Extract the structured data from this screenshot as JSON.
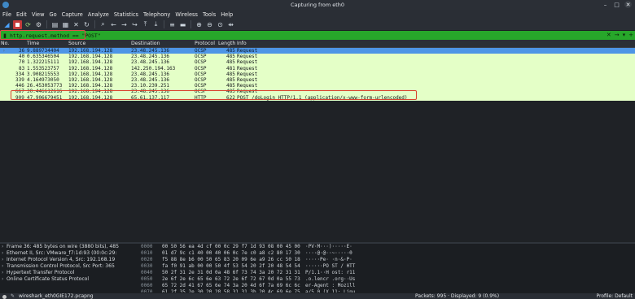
{
  "window": {
    "title": "Capturing from eth0",
    "buttons": [
      "–",
      "□",
      "✕"
    ]
  },
  "menu": [
    "File",
    "Edit",
    "View",
    "Go",
    "Capture",
    "Analyze",
    "Statistics",
    "Telephony",
    "Wireless",
    "Tools",
    "Help"
  ],
  "toolbar_icons": [
    "shark-fin-icon",
    "stop-capture-icon",
    "restart-capture-icon",
    "capture-options-icon",
    "open-file-icon",
    "save-file-icon",
    "close-file-icon",
    "reload-icon",
    "find-packet-icon",
    "back-icon",
    "forward-icon",
    "go-to-packet-icon",
    "first-packet-icon",
    "last-packet-icon",
    "autoscroll-icon",
    "colorize-icon",
    "zoom-in-icon",
    "zoom-out-icon",
    "zoom-normal-icon",
    "resize-columns-icon"
  ],
  "filter": {
    "value": "http.request.method == \"POST\""
  },
  "columns": {
    "no": "No.",
    "time": "Time",
    "source": "Source",
    "destination": "Destination",
    "protocol": "Protocol",
    "length": "Length",
    "info": "Info"
  },
  "packets": [
    {
      "no": "36",
      "time": "9.889734404",
      "source": "192.168.194.128",
      "destination": "23.48.245.136",
      "protocol": "OCSP",
      "length": "485",
      "info": "Request",
      "selected": true
    },
    {
      "no": "40",
      "time": "0.635346504",
      "source": "192.168.194.128",
      "destination": "23.48.245.136",
      "protocol": "OCSP",
      "length": "485",
      "info": "Request"
    },
    {
      "no": "70",
      "time": "1.322215111",
      "source": "192.168.194.128",
      "destination": "23.48.245.136",
      "protocol": "OCSP",
      "length": "485",
      "info": "Request"
    },
    {
      "no": "83",
      "time": "1.553523757",
      "source": "192.168.194.128",
      "destination": "142.250.194.163",
      "protocol": "OCSP",
      "length": "481",
      "info": "Request"
    },
    {
      "no": "334",
      "time": "3.908215553",
      "source": "192.168.194.128",
      "destination": "23.48.245.136",
      "protocol": "OCSP",
      "length": "485",
      "info": "Request"
    },
    {
      "no": "339",
      "time": "4.164973050",
      "source": "192.168.194.128",
      "destination": "23.48.245.136",
      "protocol": "OCSP",
      "length": "485",
      "info": "Request"
    },
    {
      "no": "446",
      "time": "26.453053773",
      "source": "192.168.194.128",
      "destination": "23.10.239.251",
      "protocol": "OCSP",
      "length": "485",
      "info": "Request"
    },
    {
      "no": "667",
      "time": "30.446612616",
      "source": "192.168.194.128",
      "destination": "23.48.245.136",
      "protocol": "OCSP",
      "length": "485",
      "info": "Request"
    },
    {
      "no": "909",
      "time": "47.906679451",
      "source": "192.168.194.128",
      "destination": "65.61.137.117",
      "protocol": "HTTP",
      "length": "622",
      "info": "POST /doLogin HTTP/1.1  (application/x-www-form-urlencoded)"
    }
  ],
  "details": [
    "Frame 36: 485 bytes on wire (3880 bits), 485",
    "Ethernet II, Src: VMware_f7:1d:93 (00:0c:29:",
    "Internet Protocol Version 4, Src: 192.168.19",
    "Transmission Control Protocol, Src Port: 365",
    "Hypertext Transfer Protocol",
    "Online Certificate Status Protocol"
  ],
  "bytes": [
    {
      "offset": "0000",
      "hex": "00 50 56 ea 4d cf 00 0c  29 f7 1d 93 08 00 45 00",
      "ascii": "·PV·M···)·····E·"
    },
    {
      "offset": "0010",
      "hex": "01 d7 9c c1 40 00 40 06  0c 7e c0 a8 c2 80 17 30",
      "ascii": "····@·@··~·····0"
    },
    {
      "offset": "0020",
      "hex": "f5 88 8e b6 00 50 65 83  20 09 6e a9 26 cc 50 18",
      "ascii": "·····Pe· ·n·&·P·"
    },
    {
      "offset": "0030",
      "hex": "fa f0 91 ab 00 00 50 4f  53 54 20 2f 20 48 54 54",
      "ascii": "······PO ST / HTT"
    },
    {
      "offset": "0040",
      "hex": "50 2f 31 2e 31 0d 0a 48  6f 73 74 3a 20 72 31 31",
      "ascii": "P/1.1··H ost: r11"
    },
    {
      "offset": "0050",
      "hex": "2e 6f 2e 6c 65 6e 63 72  2e 6f 72 67 0d 0a 55 73",
      "ascii": ".o.lencr .org··Us"
    },
    {
      "offset": "0060",
      "hex": "65 72 2d 41 67 65 6e 74  3a 20 4d 6f 7a 69 6c 6c",
      "ascii": "er-Agent : Mozill"
    },
    {
      "offset": "0070",
      "hex": "61 2f 35 2e 30 20 28 58  31 31 3b 20 4c 69 6e 75",
      "ascii": "a/5.0 (X 11; Linu"
    }
  ],
  "status": {
    "file": "wireshark_eth0GIE172.pcapng",
    "packets": "Packets: 995 · Displayed: 9 (0.9%)",
    "profile": "Profile: Default"
  },
  "colors": {
    "selected_row": "#4e95e6",
    "ocsp_row": "#e4ffc7",
    "filter_ok": "#27a72a",
    "highlight_box": "#d9452f"
  }
}
